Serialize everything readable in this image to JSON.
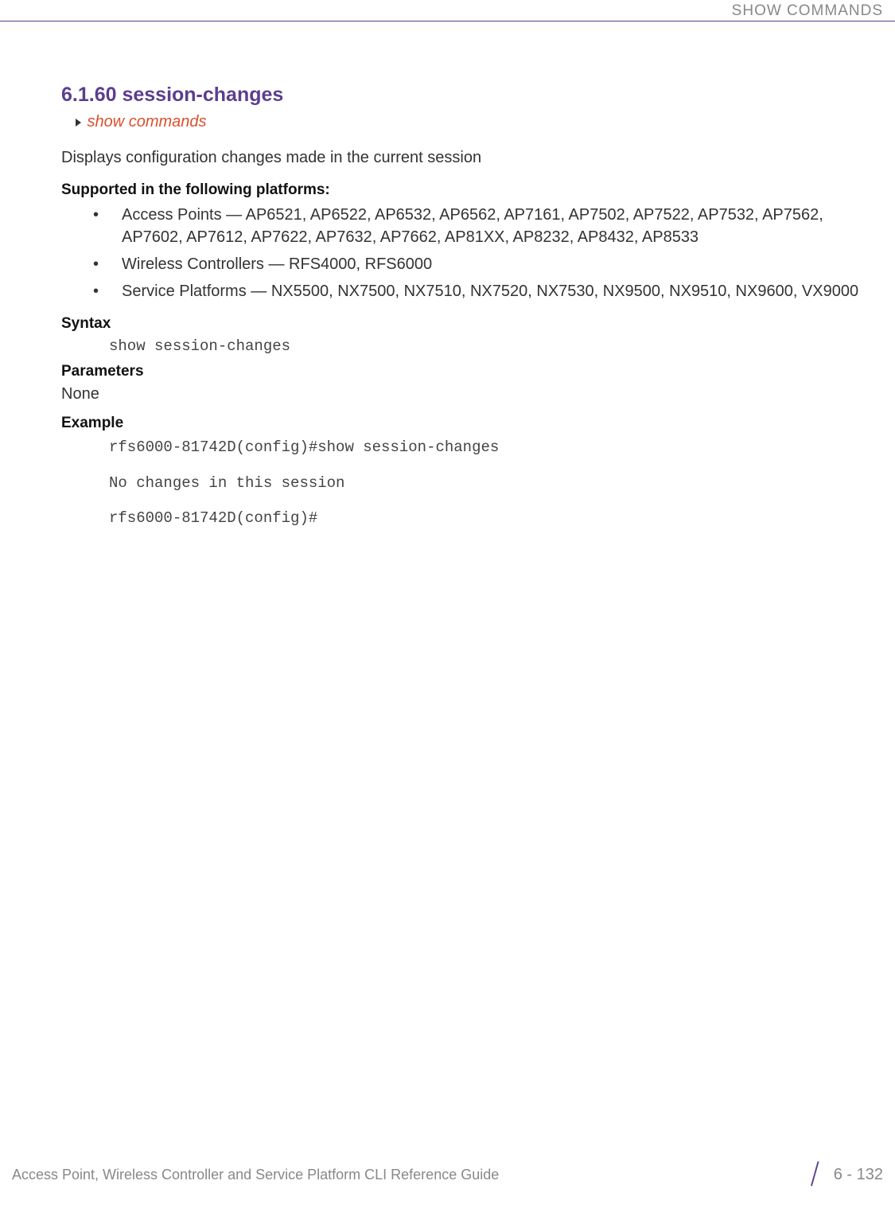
{
  "header": {
    "label": "SHOW COMMANDS"
  },
  "section": {
    "number_title": "6.1.60 session-changes",
    "link_text": "show commands",
    "description": "Displays configuration changes made in the current session"
  },
  "supported": {
    "heading": "Supported in the following platforms:",
    "items": [
      "Access Points — AP6521, AP6522, AP6532, AP6562, AP7161, AP7502, AP7522, AP7532, AP7562, AP7602, AP7612, AP7622, AP7632, AP7662, AP81XX, AP8232, AP8432, AP8533",
      "Wireless Controllers — RFS4000, RFS6000",
      "Service Platforms — NX5500, NX7500, NX7510, NX7520, NX7530, NX9500, NX9510, NX9600, VX9000"
    ]
  },
  "syntax": {
    "heading": "Syntax",
    "code": "show session-changes"
  },
  "parameters": {
    "heading": "Parameters",
    "value": "None"
  },
  "example": {
    "heading": "Example",
    "line1": "rfs6000-81742D(config)#show session-changes",
    "line2": "No changes in this session",
    "line3": "rfs6000-81742D(config)#"
  },
  "footer": {
    "guide_title": "Access Point, Wireless Controller and Service Platform CLI Reference Guide",
    "page_number": "6 - 132"
  }
}
